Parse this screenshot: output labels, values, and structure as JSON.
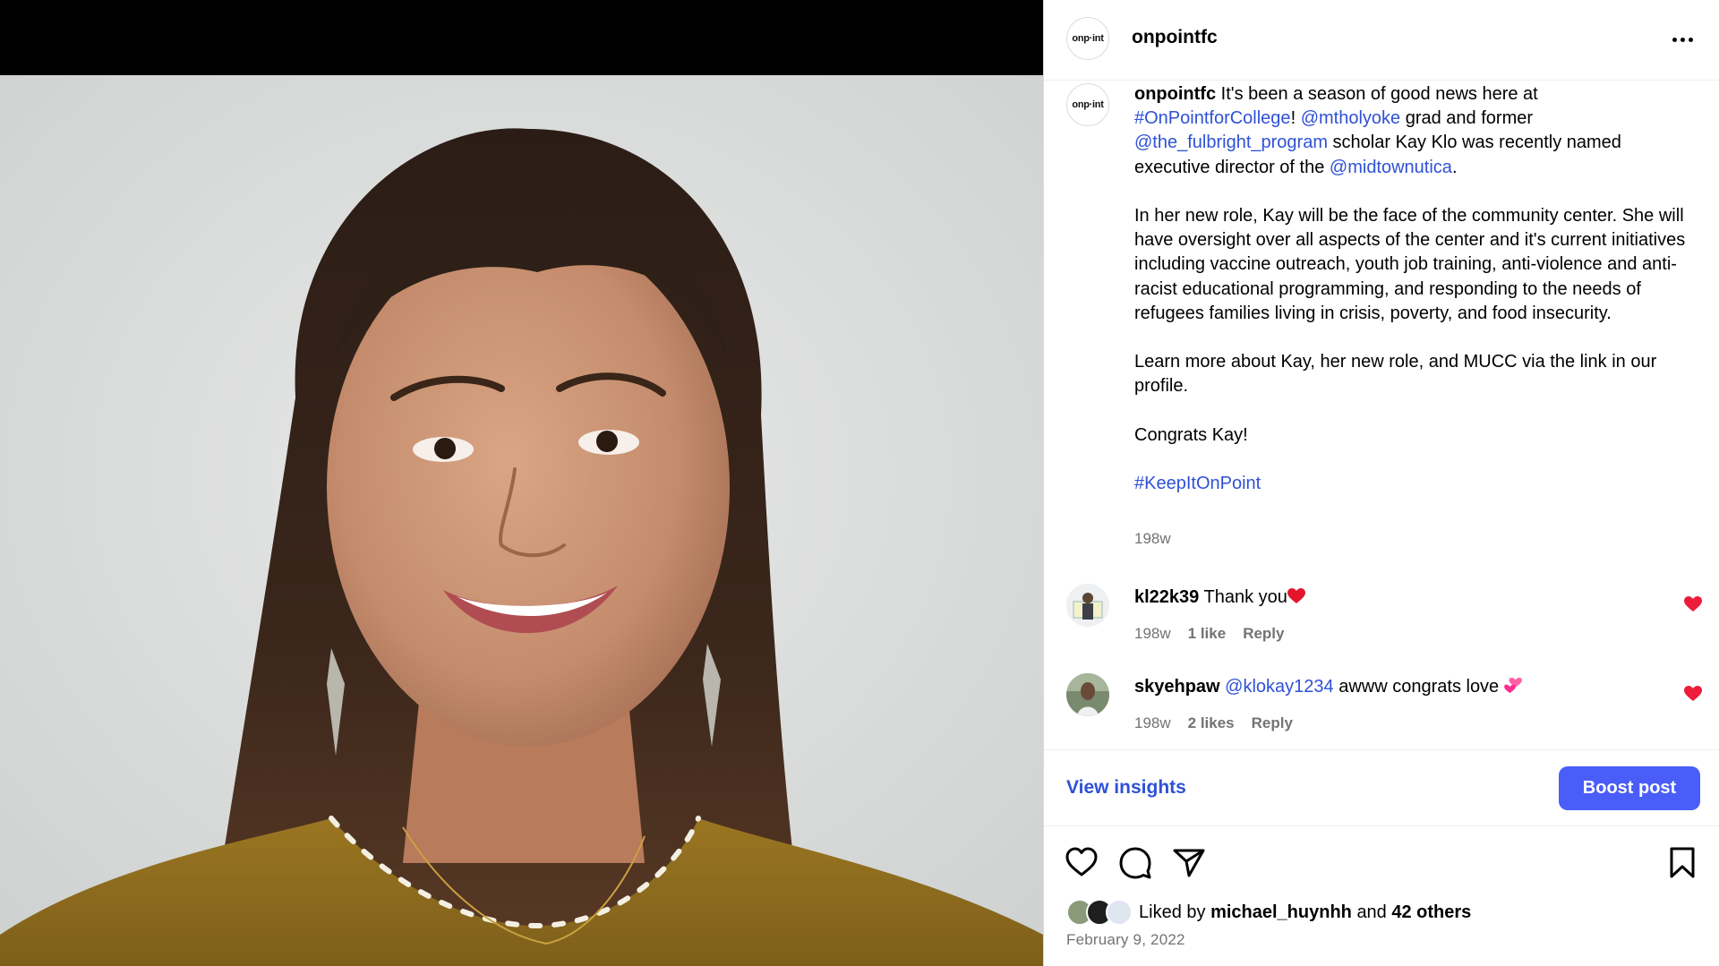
{
  "post": {
    "username": "onpointfc",
    "avatar_text": "onp·int",
    "more_icon": "more-horizontal-icon"
  },
  "caption": {
    "username": "onpointfc",
    "line1_pre": "It's been a season of good news here at",
    "hashtag1": "#OnPointforCollege",
    "bang": "!",
    "mention1": "@mtholyoke",
    "line2_mid": "grad and former",
    "mention2": "@the_fulbright_program",
    "line3_mid": "scholar Kay Klo was recently named executive director of the",
    "mention3": "@midtownutica",
    "period": ".",
    "para2": "In her new role, Kay will be the face of the community center. She will have oversight over all aspects of the center and it's current initiatives including vaccine outreach, youth job training, anti-violence and anti-racist educational programming, and responding to the needs of refugees families living in crisis, poverty, and food insecurity.",
    "para3": "Learn more about Kay, her new role, and MUCC via the link in our profile.",
    "para4": "Congrats Kay!",
    "hashtag2": "#KeepItOnPoint",
    "timestamp": "198w"
  },
  "comments": [
    {
      "username": "kl22k39",
      "text": "Thank you",
      "emoji": "red-heart",
      "age": "198w",
      "likes": "1 like",
      "reply": "Reply"
    },
    {
      "username": "skyehpaw",
      "mention": "@klokay1234",
      "text": "awww congrats love",
      "emoji": "two-hearts",
      "age": "198w",
      "likes": "2 likes",
      "reply": "Reply"
    }
  ],
  "insights": {
    "view_label": "View insights",
    "boost_label": "Boost post"
  },
  "actions": {
    "like_icon": "heart-icon",
    "comment_icon": "comment-icon",
    "share_icon": "share-icon",
    "save_icon": "bookmark-icon"
  },
  "likes": {
    "prefix": "Liked by",
    "user": "michael_huynhh",
    "and": "and",
    "others": "42 others"
  },
  "date": "February 9, 2022",
  "colors": {
    "link": "#2f51d6",
    "boost": "#4a5df9",
    "heart": "#ed1c3b",
    "muted": "#737373"
  }
}
